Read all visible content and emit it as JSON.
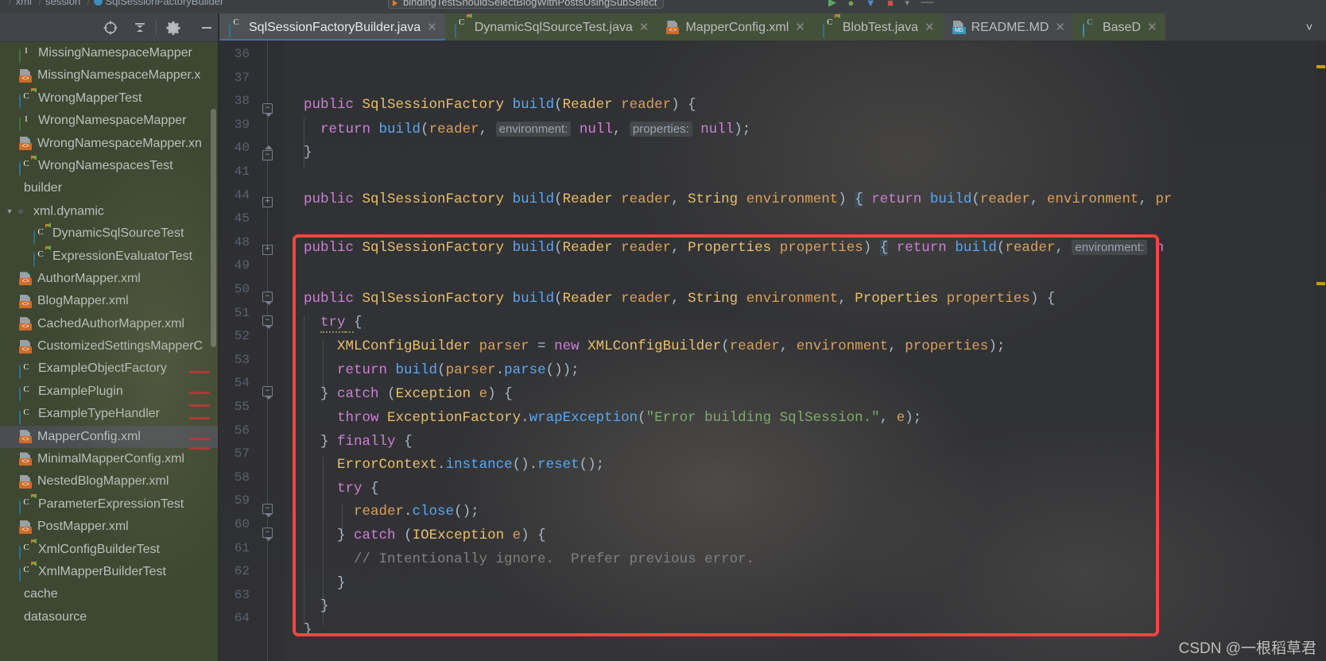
{
  "window": {
    "breadcrumb": [
      "...",
      "xml",
      "session",
      "SqlSessionFactoryBuilder"
    ],
    "run_config": "bindingTestShouldSelectBlogWithPostsUsingSubSelect"
  },
  "project_panel": {
    "toolbar_icons": [
      "locate-icon",
      "collapse-all-icon",
      "settings-gear-icon",
      "minimize-icon"
    ],
    "items": [
      {
        "label": "MissingNamespaceMapper",
        "icon": "interface-icon",
        "indent": 1
      },
      {
        "label": "MissingNamespaceMapper.x",
        "icon": "xml-file-icon",
        "indent": 1
      },
      {
        "label": "WrongMapperTest",
        "icon": "test-class-icon",
        "indent": 1
      },
      {
        "label": "WrongNamespaceMapper",
        "icon": "interface-icon",
        "indent": 1
      },
      {
        "label": "WrongNamespaceMapper.xn",
        "icon": "xml-file-icon",
        "indent": 1
      },
      {
        "label": "WrongNamespacesTest",
        "icon": "test-class-icon",
        "indent": 1
      },
      {
        "label": "builder",
        "icon": "package-icon",
        "indent": 0
      },
      {
        "label": "xml.dynamic",
        "icon": "folder-icon",
        "indent": 0,
        "twisty": "expanded"
      },
      {
        "label": "DynamicSqlSourceTest",
        "icon": "test-class-icon",
        "indent": 2
      },
      {
        "label": "ExpressionEvaluatorTest",
        "icon": "test-class-icon",
        "indent": 2
      },
      {
        "label": "AuthorMapper.xml",
        "icon": "xml-file-icon",
        "indent": 1
      },
      {
        "label": "BlogMapper.xml",
        "icon": "xml-file-icon",
        "indent": 1
      },
      {
        "label": "CachedAuthorMapper.xml",
        "icon": "xml-file-icon",
        "indent": 1
      },
      {
        "label": "CustomizedSettingsMapperC",
        "icon": "xml-file-icon",
        "indent": 1
      },
      {
        "label": "ExampleObjectFactory",
        "icon": "class-icon",
        "indent": 1
      },
      {
        "label": "ExamplePlugin",
        "icon": "class-icon",
        "indent": 1
      },
      {
        "label": "ExampleTypeHandler",
        "icon": "class-icon",
        "indent": 1
      },
      {
        "label": "MapperConfig.xml",
        "icon": "xml-file-icon",
        "indent": 1,
        "selected": true
      },
      {
        "label": "MinimalMapperConfig.xml",
        "icon": "xml-file-icon",
        "indent": 1
      },
      {
        "label": "NestedBlogMapper.xml",
        "icon": "xml-file-icon",
        "indent": 1
      },
      {
        "label": "ParameterExpressionTest",
        "icon": "test-class-icon",
        "indent": 1
      },
      {
        "label": "PostMapper.xml",
        "icon": "xml-file-icon",
        "indent": 1
      },
      {
        "label": "XmlConfigBuilderTest",
        "icon": "test-class-icon",
        "indent": 1
      },
      {
        "label": "XmlMapperBuilderTest",
        "icon": "test-class-icon",
        "indent": 1
      },
      {
        "label": "cache",
        "icon": "package-icon",
        "indent": 0
      },
      {
        "label": "datasource",
        "icon": "package-icon",
        "indent": 0
      }
    ]
  },
  "tabs": [
    {
      "label": "SqlSessionFactoryBuilder.java",
      "icon": "java-class-icon",
      "active": true,
      "style": "active"
    },
    {
      "label": "DynamicSqlSourceTest.java",
      "icon": "test-class-icon",
      "active": false,
      "style": "green"
    },
    {
      "label": "MapperConfig.xml",
      "icon": "xml-file-icon",
      "active": false,
      "style": "green"
    },
    {
      "label": "BlobTest.java",
      "icon": "test-class-icon",
      "active": false,
      "style": "green"
    },
    {
      "label": "README.MD",
      "icon": "markdown-icon",
      "active": false,
      "style": "gray"
    },
    {
      "label": "BaseD",
      "icon": "abstract-class-icon",
      "active": false,
      "style": "green"
    }
  ],
  "tab_overflow_icon": "chevron-down-icon",
  "editor": {
    "line_numbers": [
      "36",
      "37",
      "38",
      "39",
      "40",
      "41",
      "44",
      "45",
      "48",
      "49",
      "50",
      "51",
      "52",
      "53",
      "54",
      "55",
      "56",
      "57",
      "58",
      "59",
      "60",
      "61",
      "62",
      "63",
      "64"
    ],
    "code_lines": [
      "",
      "public SqlSessionFactory build(Reader reader) {",
      "  return build(reader, environment: null, properties: null);",
      "}",
      "",
      "public SqlSessionFactory build(Reader reader, String environment) { return build(reader, environment, pr",
      "",
      "public SqlSessionFactory build(Reader reader, Properties properties) { return build(reader, environment: n",
      "",
      "public SqlSessionFactory build(Reader reader, String environment, Properties properties) {",
      "  try {",
      "    XMLConfigBuilder parser = new XMLConfigBuilder(reader, environment, properties);",
      "    return build(parser.parse());",
      "  } catch (Exception e) {",
      "    throw ExceptionFactory.wrapException(\"Error building SqlSession.\", e);",
      "  } finally {",
      "    ErrorContext.instance().reset();",
      "    try {",
      "      reader.close();",
      "    } catch (IOException e) {",
      "      // Intentionally ignore.  Prefer previous error.",
      "    }",
      "  }",
      "}",
      ""
    ],
    "inlay_hints": [
      "environment:",
      "properties:",
      "environment:"
    ],
    "string_literal": "\"Error building SqlSession.\"",
    "comment": "// Intentionally ignore.  Prefer previous error."
  },
  "annotation": {
    "color": "#f4453f",
    "shape": "rounded-rectangle"
  },
  "watermark": "CSDN @一根稻草君",
  "colors": {
    "editor_bg": "#2f3033",
    "panel_bg": "#3c3f41",
    "tree_bg": "#3d4731",
    "accent_tab_underline": "#4b6eaf",
    "keyword": "#cc7fd4",
    "type": "#e8bf6a",
    "method": "#56a8f5",
    "param": "#d9a05b",
    "string": "#7fab6b",
    "comment": "#808080",
    "annotation_red": "#f4453f"
  }
}
